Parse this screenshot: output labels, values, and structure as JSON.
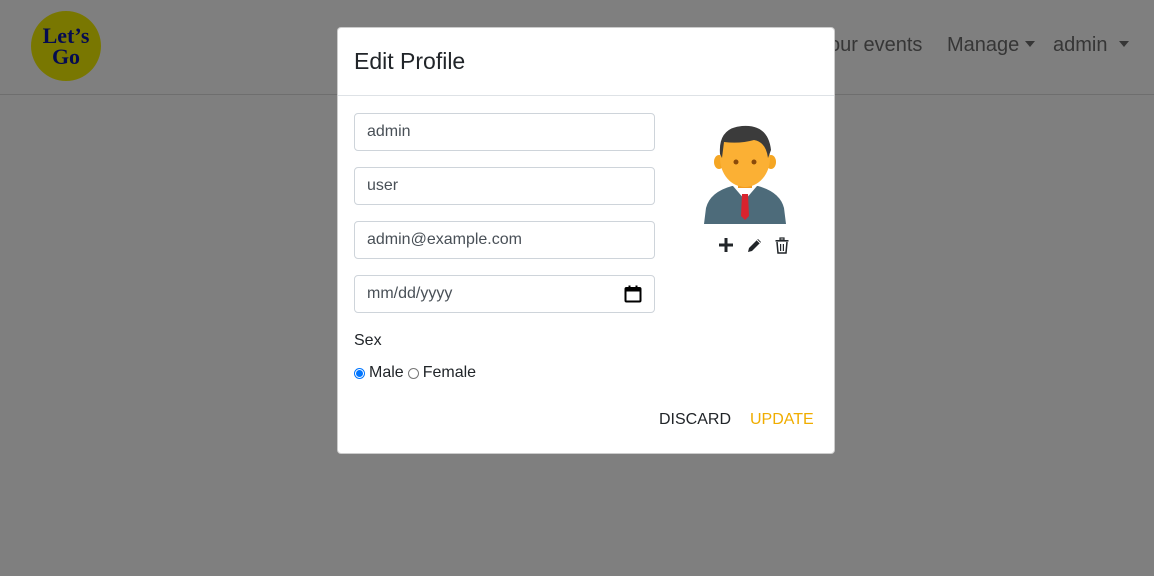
{
  "navbar": {
    "logo_line1": "Let’s",
    "logo_line2": "Go",
    "items": [
      {
        "label": "our events"
      },
      {
        "label": "Manage"
      },
      {
        "label": "admin"
      }
    ]
  },
  "modal": {
    "title": "Edit Profile",
    "first_name_value": "admin",
    "last_name_value": "user",
    "email_value": "admin@example.com",
    "date_placeholder": "mm/dd/yyyy",
    "sex_label": "Sex",
    "sex_options": [
      "Male",
      "Female"
    ],
    "sex_selected": "Male",
    "avatar_actions": [
      "plus-icon",
      "pencil-icon",
      "trash-icon"
    ],
    "discard_label": "DISCARD",
    "update_label": "UPDATE"
  },
  "colors": {
    "accent": "#f0ad00",
    "radio_selected": "#0075ff",
    "logo_bg": "#f3ef02",
    "logo_text": "#0b17a0"
  }
}
